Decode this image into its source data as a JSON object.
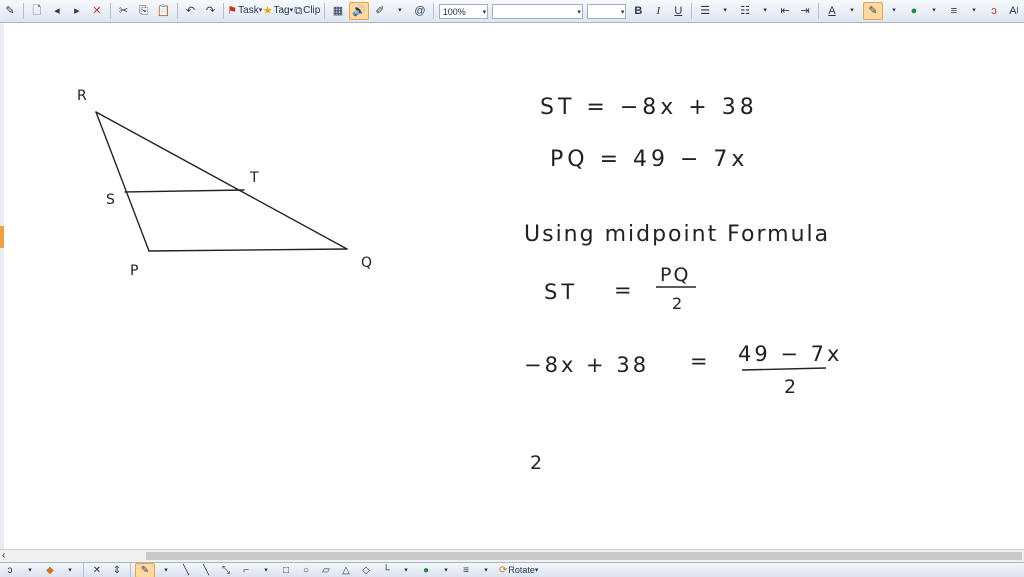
{
  "toolbar": {
    "zoom": "100%",
    "task_label": "Task",
    "tag_label": "Tag",
    "clip_label": "Clip",
    "font_name": "",
    "font_size": "",
    "bold": "B",
    "italic": "I",
    "underline": "U",
    "text_color": "A",
    "font_big": "A",
    "font_small": "I"
  },
  "bottombar": {
    "rotate_label": "Rotate"
  },
  "note": {
    "vertices": {
      "R": "R",
      "S": "S",
      "T": "T",
      "P": "P",
      "Q": "Q"
    },
    "lines": {
      "st_eq": "ST = −8x + 38",
      "pq_eq": "PQ = 49 − 7x",
      "using": "Using midpoint Formula",
      "st_lhs": "ST",
      "equals1": "=",
      "pq_num": "PQ",
      "den1": "2",
      "lhs2": "−8x + 38",
      "equals2": "=",
      "num2": "49 − 7x",
      "den2": "2",
      "trail": "2"
    }
  },
  "colors": {
    "ink": "#222222",
    "toolbar_bg": "#dfe6f1",
    "accent": "#f0a040"
  }
}
